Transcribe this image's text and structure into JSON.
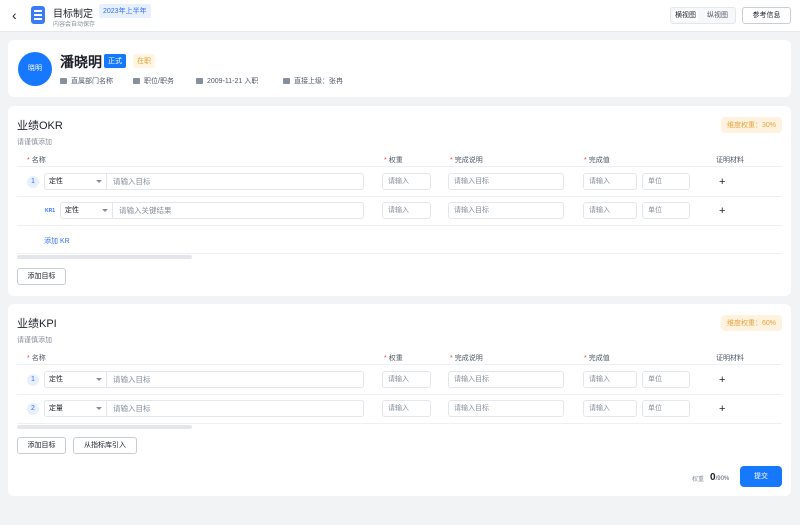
{
  "header": {
    "back_icon": "chevron-left-icon",
    "app_icon": "document-icon",
    "title": "目标制定",
    "period_tag": "2023年上半年",
    "autosave": "内容会自动保存",
    "view_horizontal": "横视图",
    "view_vertical": "纵视图",
    "reference_button": "参考信息"
  },
  "profile": {
    "avatar_text": "晓明",
    "name": "潘晓明",
    "tag_formal": "正式",
    "tag_status": "在职",
    "department": "直属部门名称",
    "position": "职位/职务",
    "join_date": "2009-11-21 入职",
    "supervisor": "直接上级：张冉"
  },
  "okr": {
    "title": "业绩OKR",
    "hint": "请谨慎添加",
    "weight_badge": "维度权重：30%",
    "columns": {
      "name": "名称",
      "weight": "权重",
      "description": "完成说明",
      "value": "完成值",
      "evidence": "证明材料"
    },
    "rows": [
      {
        "index": "1",
        "type": "定性",
        "goal_placeholder": "请输入目标",
        "weight": "请输入",
        "description": "请输入目标",
        "value": "请输入",
        "unit": "单位"
      },
      {
        "index": "KR1",
        "type": "定性",
        "goal_placeholder": "请输入关键结果",
        "weight": "请输入",
        "description": "请输入目标",
        "value": "请输入",
        "unit": "单位"
      }
    ],
    "add_kr": "添加 KR",
    "add_goal": "添加目标"
  },
  "kpi": {
    "title": "业绩KPI",
    "hint": "请谨慎添加",
    "weight_badge": "维度权重：60%",
    "columns": {
      "name": "名称",
      "weight": "权重",
      "description": "完成说明",
      "value": "完成值",
      "evidence": "证明材料"
    },
    "rows": [
      {
        "index": "1",
        "type": "定性",
        "goal_placeholder": "请输入目标",
        "weight": "请输入",
        "description": "请输入目标",
        "value": "请输入",
        "unit": "单位"
      },
      {
        "index": "2",
        "type": "定量",
        "goal_placeholder": "请输入目标",
        "weight": "请输入",
        "description": "请输入目标",
        "value": "请输入",
        "unit": "单位"
      }
    ],
    "add_goal": "添加目标",
    "import": "从指标库引入"
  },
  "summary": {
    "weight_label": "权重",
    "weight_value": "0",
    "weight_total": "/90%",
    "submit": "提交"
  },
  "colors": {
    "primary": "#1677ff",
    "warning": "#e6a23c",
    "danger": "#f53f3f"
  }
}
